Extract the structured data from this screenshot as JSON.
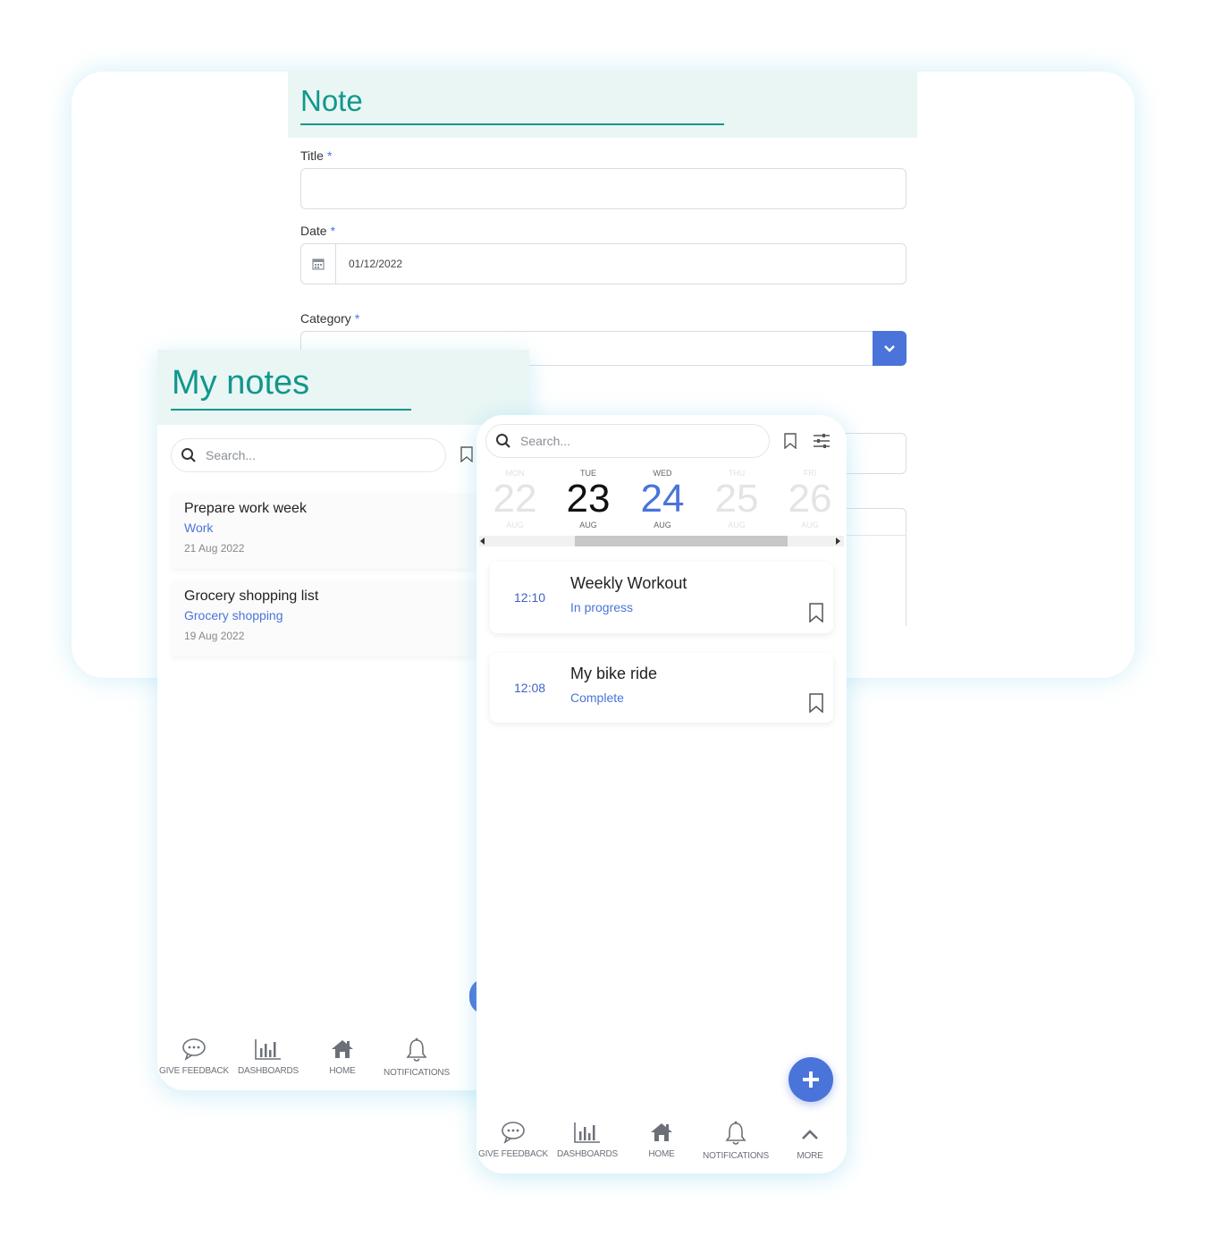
{
  "note_form": {
    "heading": "Note",
    "title_label": "Title",
    "date_label": "Date",
    "date_value": "01/12/2022",
    "category_label": "Category",
    "required_mark": "*"
  },
  "my_notes": {
    "heading": "My notes",
    "search_placeholder": "Search...",
    "items": [
      {
        "title": "Prepare work week",
        "category": "Work",
        "date": "21 Aug 2022"
      },
      {
        "title": "Grocery shopping list",
        "category": "Grocery shopping",
        "date": "19 Aug 2022"
      }
    ],
    "nav": [
      {
        "label": "GIVE FEEDBACK",
        "icon": "chat-bubble-icon"
      },
      {
        "label": "DASHBOARDS",
        "icon": "bar-chart-icon"
      },
      {
        "label": "HOME",
        "icon": "home-icon"
      },
      {
        "label": "NOTIFICATIONS",
        "icon": "bell-icon"
      }
    ]
  },
  "calendar": {
    "search_placeholder": "Search...",
    "days": [
      {
        "dow": "MON",
        "num": "22",
        "mon": "AUG",
        "state": "faded"
      },
      {
        "dow": "TUE",
        "num": "23",
        "mon": "AUG",
        "state": "normal"
      },
      {
        "dow": "WED",
        "num": "24",
        "mon": "AUG",
        "state": "selected"
      },
      {
        "dow": "THU",
        "num": "25",
        "mon": "AUG",
        "state": "faded"
      },
      {
        "dow": "FRI",
        "num": "26",
        "mon": "AUG",
        "state": "faded"
      }
    ],
    "activities": [
      {
        "time": "12:10",
        "title": "Weekly Workout",
        "status": "In progress"
      },
      {
        "time": "12:08",
        "title": "My bike ride",
        "status": "Complete"
      }
    ],
    "nav": [
      {
        "label": "GIVE FEEDBACK",
        "icon": "chat-bubble-icon"
      },
      {
        "label": "DASHBOARDS",
        "icon": "bar-chart-icon"
      },
      {
        "label": "HOME",
        "icon": "home-icon"
      },
      {
        "label": "NOTIFICATIONS",
        "icon": "bell-icon"
      },
      {
        "label": "MORE",
        "icon": "chevron-up-icon"
      }
    ]
  },
  "colors": {
    "teal": "#12978d",
    "accent_blue": "#4a74d9",
    "header_bg": "#e9f6f4"
  }
}
